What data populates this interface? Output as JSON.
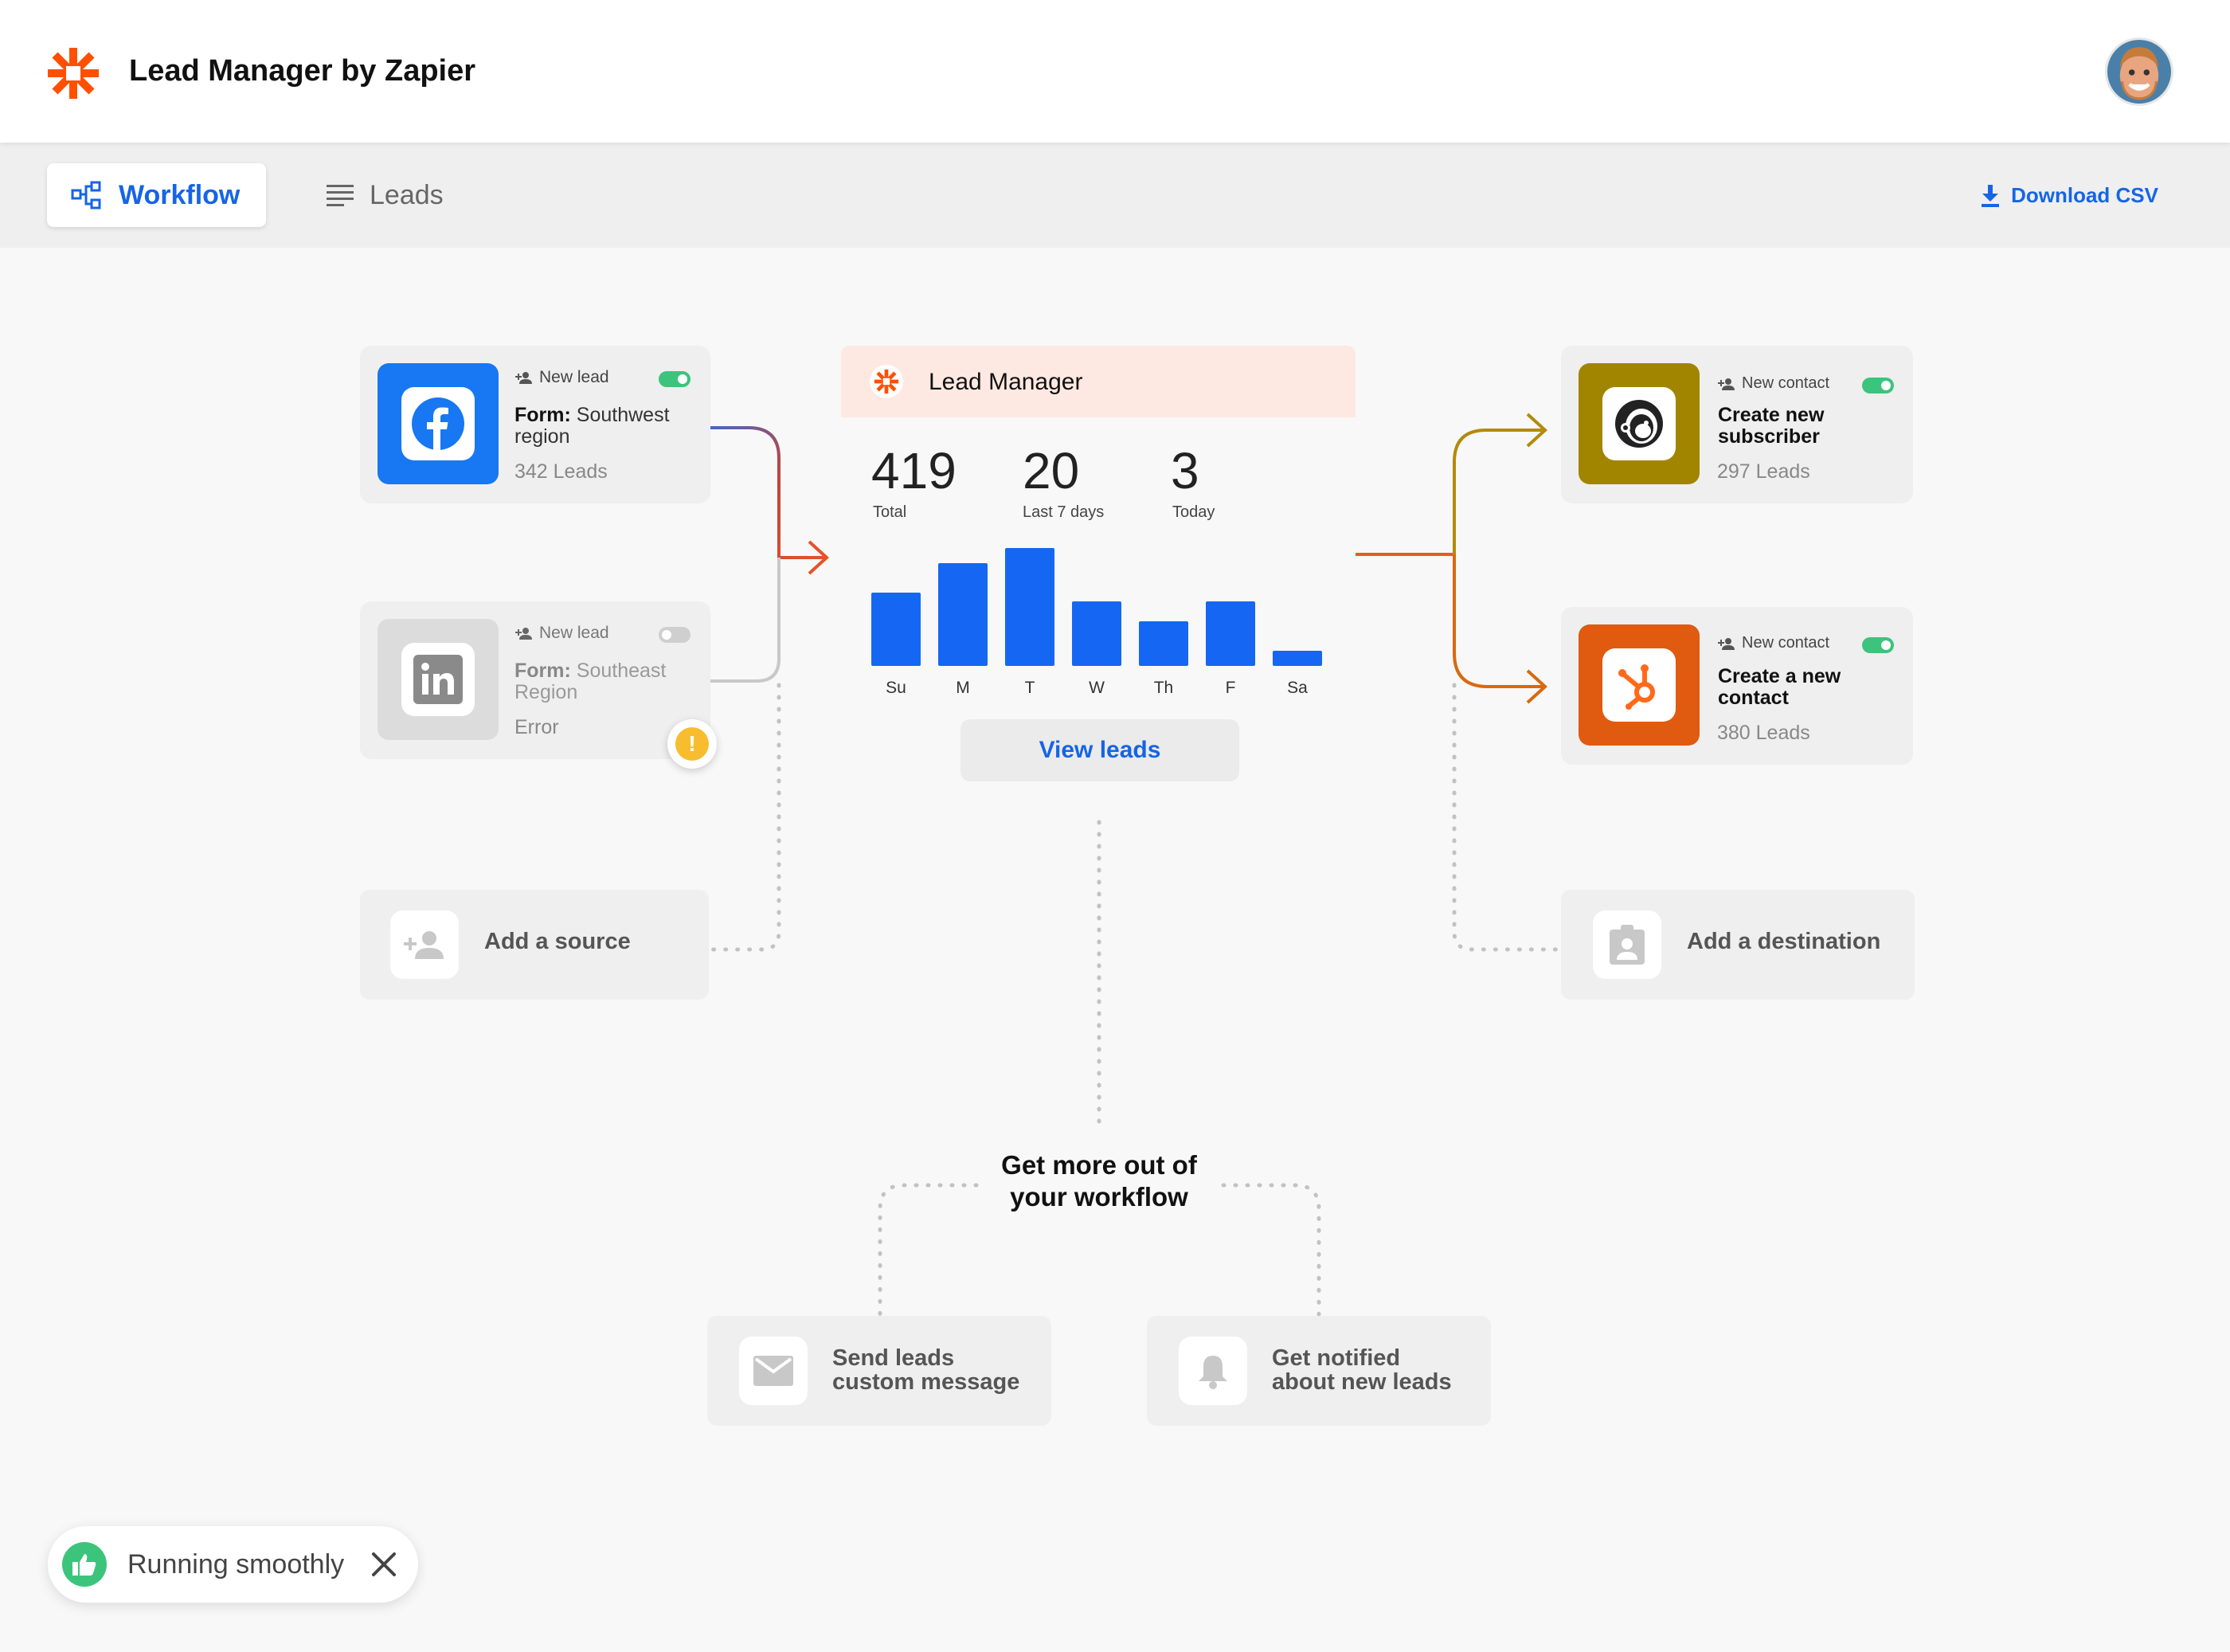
{
  "app": {
    "title": "Lead Manager by Zapier"
  },
  "tabs": {
    "workflow": "Workflow",
    "leads": "Leads",
    "download": "Download CSV"
  },
  "sources": [
    {
      "app": "Facebook",
      "trigger": "New lead",
      "form_label": "Form:",
      "form_value": "Southwest region",
      "status": "342 Leads",
      "enabled": true,
      "color": "#1877f2"
    },
    {
      "app": "LinkedIn",
      "trigger": "New lead",
      "form_label": "Form:",
      "form_value": "Southeast Region",
      "status": "Error",
      "enabled": false,
      "color": "#d0d0d0"
    }
  ],
  "destinations": [
    {
      "app": "Mailchimp",
      "trigger": "New contact",
      "action": "Create new subscriber",
      "status": "297 Leads",
      "enabled": true,
      "color": "#a18500"
    },
    {
      "app": "HubSpot",
      "trigger": "New contact",
      "action": "Create a new contact",
      "status": "380 Leads",
      "enabled": true,
      "color": "#e05a0f"
    }
  ],
  "lead_manager": {
    "title": "Lead Manager",
    "stats": [
      {
        "value": "419",
        "label": "Total"
      },
      {
        "value": "20",
        "label": "Last 7 days"
      },
      {
        "value": "3",
        "label": "Today"
      }
    ],
    "chart_data": {
      "type": "bar",
      "categories": [
        "Su",
        "M",
        "T",
        "W",
        "Th",
        "F",
        "Sa"
      ],
      "values": [
        0.62,
        0.87,
        1.0,
        0.55,
        0.38,
        0.55,
        0.13
      ]
    },
    "view_button": "View leads"
  },
  "add_source": "Add a source",
  "add_destination": "Add a destination",
  "more": {
    "title_line1": "Get more out of",
    "title_line2": "your workflow",
    "send_line1": "Send leads",
    "send_line2": "custom message",
    "notify_line1": "Get notified",
    "notify_line2": "about new leads"
  },
  "toast": {
    "text": "Running smoothly"
  },
  "colors": {
    "accent": "#1565e6",
    "zapier": "#ff4f00",
    "success": "#3cc47c",
    "warning": "#f8bd2f"
  }
}
